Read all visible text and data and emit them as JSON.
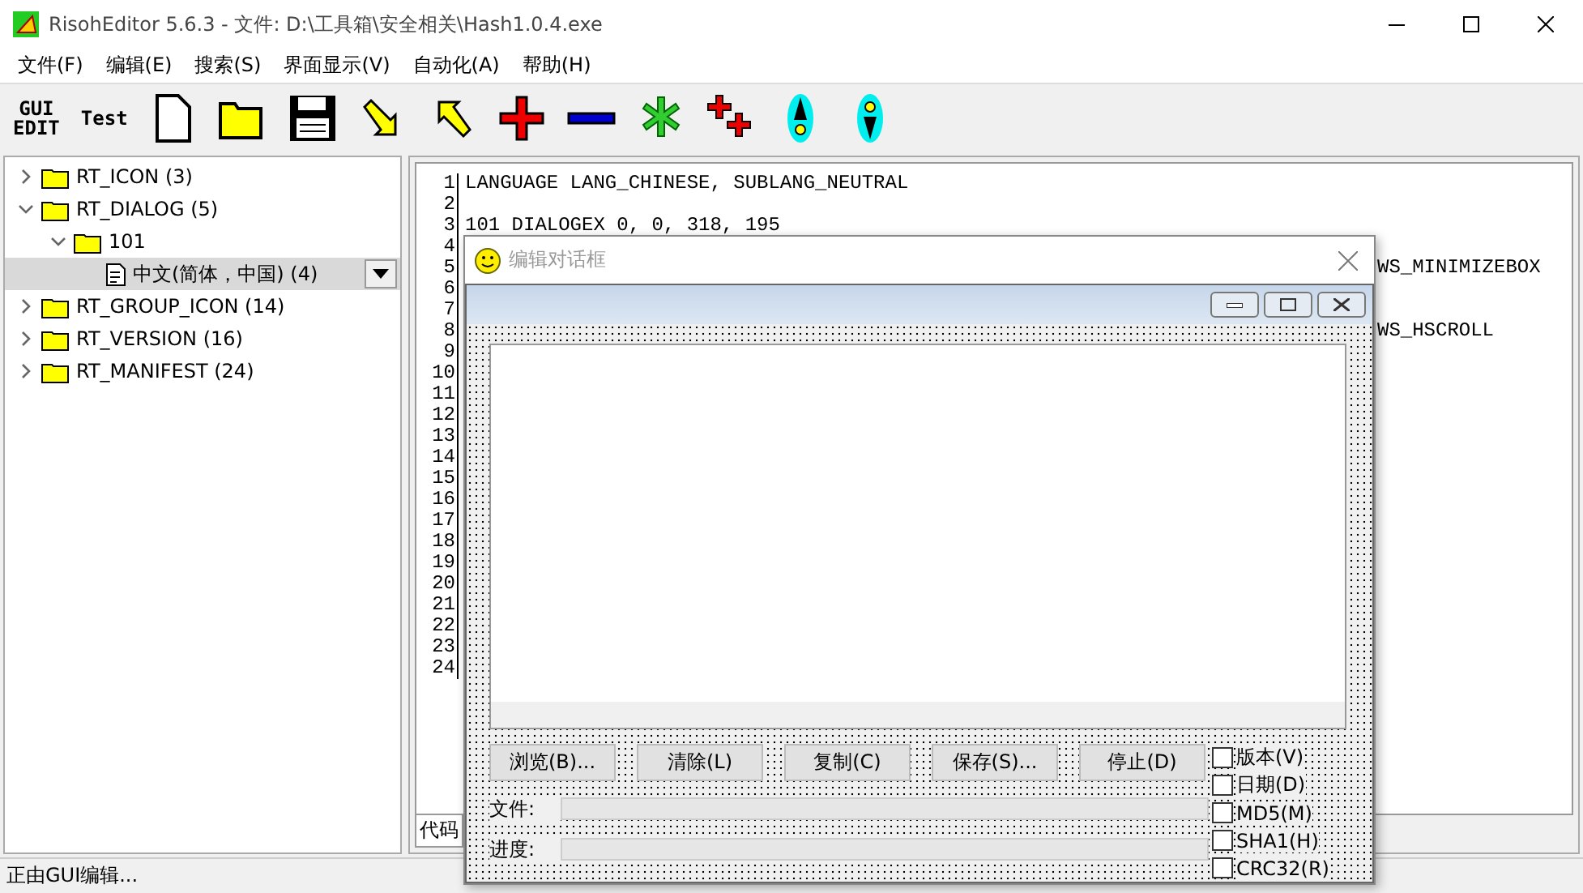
{
  "window": {
    "title": "RisohEditor 5.6.3 - 文件: D:\\工具箱\\安全相关\\Hash1.0.4.exe"
  },
  "menu": [
    "文件(F)",
    "编辑(E)",
    "搜索(S)",
    "界面显示(V)",
    "自动化(A)",
    "帮助(H)"
  ],
  "toolbar": [
    {
      "kind": "text",
      "label": "GUI\nEDIT"
    },
    {
      "kind": "text",
      "label": "Test"
    },
    {
      "kind": "new"
    },
    {
      "kind": "open"
    },
    {
      "kind": "save"
    },
    {
      "kind": "down"
    },
    {
      "kind": "up"
    },
    {
      "kind": "add"
    },
    {
      "kind": "remove"
    },
    {
      "kind": "star"
    },
    {
      "kind": "copy"
    },
    {
      "kind": "moveup"
    },
    {
      "kind": "movedown"
    }
  ],
  "tree": [
    {
      "label": "RT_ICON (3)",
      "expanded": false
    },
    {
      "label": "RT_DIALOG (5)",
      "expanded": true,
      "children": [
        {
          "label": "101",
          "expanded": true,
          "children": [
            {
              "label": "中文(简体，中国) (4)",
              "selected": true
            }
          ]
        }
      ]
    },
    {
      "label": "RT_GROUP_ICON (14)",
      "expanded": false
    },
    {
      "label": "RT_VERSION (16)",
      "expanded": false
    },
    {
      "label": "RT_MANIFEST (24)",
      "expanded": false
    }
  ],
  "editor": {
    "lines": [
      {
        "number": "1",
        "text": "LANGUAGE LANG_CHINESE, SUBLANG_NEUTRAL"
      },
      {
        "number": "2"
      },
      {
        "number": "3",
        "text": "101 DIALOGEX 0, 0, 318, 195"
      },
      {
        "number": "4"
      },
      {
        "number": "5",
        "text": "WS_MINIMIZEBOX"
      },
      {
        "number": "6"
      },
      {
        "number": "7"
      },
      {
        "number": "8",
        "text": "WS_HSCROLL"
      },
      {
        "number": "9"
      },
      {
        "number": "10"
      },
      {
        "number": "11"
      },
      {
        "number": "12"
      },
      {
        "number": "13"
      },
      {
        "number": "14"
      },
      {
        "number": "15"
      },
      {
        "number": "16"
      },
      {
        "number": "17"
      },
      {
        "number": "18"
      },
      {
        "number": "19"
      },
      {
        "number": "20"
      },
      {
        "number": "21"
      },
      {
        "number": "22"
      },
      {
        "number": "23"
      },
      {
        "number": "24"
      }
    ],
    "tab": "代码"
  },
  "dialog": {
    "title": "编辑对话框",
    "buttons": [
      "浏览(B)...",
      "清除(L)",
      "复制(C)",
      "保存(S)...",
      "停止(D)"
    ],
    "fields": [
      {
        "label": "文件:"
      },
      {
        "label": "进度:"
      }
    ],
    "checkboxes": [
      {
        "label": "版本(V)",
        "checked": false
      },
      {
        "label": "日期(D)",
        "checked": false
      },
      {
        "label": "MD5(M)",
        "checked": false
      },
      {
        "label": "SHA1(H)",
        "checked": false
      },
      {
        "label": "CRC32(R)",
        "checked": false
      }
    ]
  },
  "status_bar": {
    "text": "正由GUI编辑..."
  }
}
